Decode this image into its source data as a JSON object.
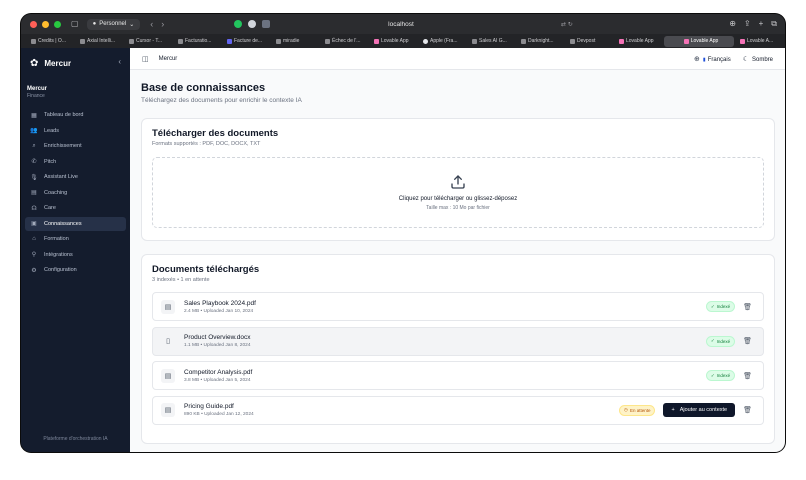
{
  "browser": {
    "profile": "Personnel",
    "url": "localhost",
    "tabs": [
      {
        "label": "Credits | O..."
      },
      {
        "label": "Axial Intelli..."
      },
      {
        "label": "Cursor - T..."
      },
      {
        "label": "Facturatio..."
      },
      {
        "label": "Facture de..."
      },
      {
        "label": "miradie"
      },
      {
        "label": "Échec de l'..."
      },
      {
        "label": "Lovable App"
      },
      {
        "label": "Apple (Fra..."
      },
      {
        "label": "Sales AI G..."
      },
      {
        "label": "Darknight..."
      },
      {
        "label": "Devpost"
      },
      {
        "label": "Lovable App"
      },
      {
        "label": "Lovable App"
      },
      {
        "label": "Lovable A..."
      }
    ]
  },
  "sidebar": {
    "brand": "Mercur",
    "org_name": "Mercur",
    "org_sub": "Finance",
    "items": [
      {
        "label": "Tableau de bord",
        "icon": "dashboard-icon"
      },
      {
        "label": "Leads",
        "icon": "users-icon"
      },
      {
        "label": "Enrichissement",
        "icon": "search-icon"
      },
      {
        "label": "Pitch",
        "icon": "phone-icon"
      },
      {
        "label": "Assistant Live",
        "icon": "mic-icon"
      },
      {
        "label": "Coaching",
        "icon": "chart-icon"
      },
      {
        "label": "Care",
        "icon": "headset-icon"
      },
      {
        "label": "Connaissances",
        "icon": "database-icon"
      },
      {
        "label": "Formation",
        "icon": "graduation-icon"
      },
      {
        "label": "Intégrations",
        "icon": "plug-icon"
      },
      {
        "label": "Configuration",
        "icon": "gear-icon"
      }
    ],
    "footer": "Plateforme d'orchestration IA"
  },
  "topbar": {
    "breadcrumb": "Mercur",
    "language": "Français",
    "theme": "Sombre"
  },
  "page": {
    "title": "Base de connaissances",
    "subtitle": "Téléchargez des documents pour enrichir le contexte IA"
  },
  "upload": {
    "title": "Télécharger des documents",
    "formats": "Formats supportés : PDF, DOC, DOCX, TXT",
    "drop_text": "Cliquez pour télécharger ou glissez-déposez",
    "size_limit": "Taille max : 10 Mo par fichier"
  },
  "documents": {
    "title": "Documents téléchargés",
    "summary": "3 indexés • 1 en attente",
    "items": [
      {
        "name": "Sales Playbook 2024.pdf",
        "meta": "2.4 MB • Uploaded Jan 10, 2024",
        "status": "Indexé"
      },
      {
        "name": "Product Overview.docx",
        "meta": "1.1 MB • Uploaded Jan 8, 2024",
        "status": "Indexé"
      },
      {
        "name": "Competitor Analysis.pdf",
        "meta": "3.8 MB • Uploaded Jan 5, 2024",
        "status": "Indexé"
      },
      {
        "name": "Pricing Guide.pdf",
        "meta": "890 KB • Uploaded Jan 12, 2024",
        "status": "En attente",
        "action": "Ajouter au contexte"
      }
    ]
  },
  "colors": {
    "sidebar_bg": "#141c2d",
    "indexed_green": "#15803d",
    "pending_amber": "#b45309",
    "primary_button": "#0f172a"
  }
}
